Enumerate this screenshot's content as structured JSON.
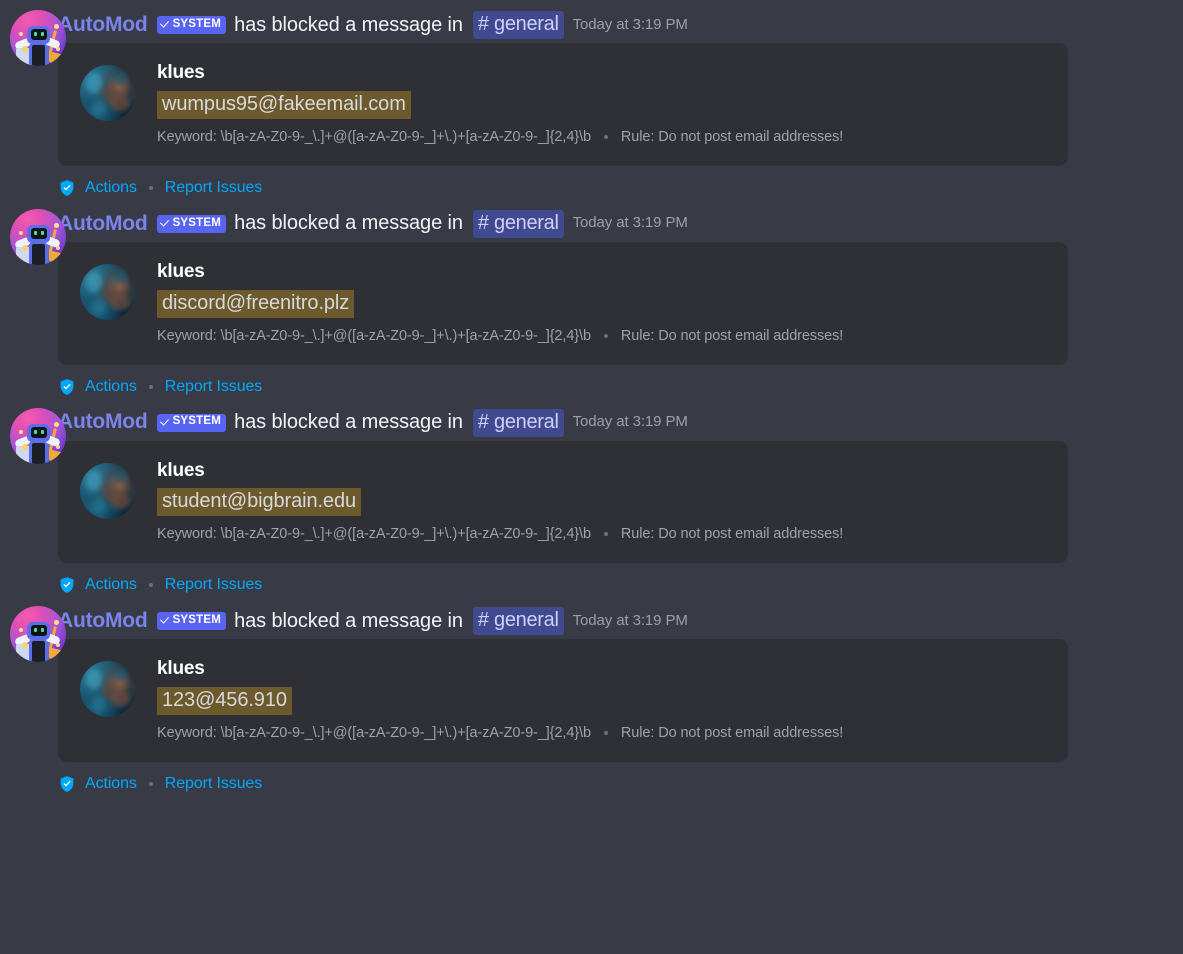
{
  "colors": {
    "page_background": "#383b45",
    "embed_background": "#2e3035",
    "bot_name": "#7a84eb",
    "system_badge": "#5865f2",
    "channel_pill_bg": "#414a8f",
    "channel_pill_text": "#ced0fa",
    "highlight_bg": "#6d5a2c",
    "link": "#00a8fc",
    "muted_text": "#9da3ab"
  },
  "labels": {
    "bot_name": "AutoMod",
    "system_badge": "SYSTEM",
    "blocked_text": "has blocked a message in",
    "channel": "# general",
    "timestamp": "Today at 3:19 PM",
    "keyword_prefix": "Keyword:",
    "rule_prefix": "Rule:",
    "actions": "Actions",
    "report_issues": "Report Issues"
  },
  "icons": {
    "shield": "shield-check-icon",
    "check": "check-icon",
    "hash": "hash-icon"
  },
  "entries": [
    {
      "bot_name": "AutoMod",
      "badge": "SYSTEM",
      "blocked_text": "has blocked a message in",
      "channel": "# general",
      "timestamp": "Today at 3:19 PM",
      "author": "klues",
      "content": "wumpus95@fakeemail.com",
      "keyword": "Keyword: \\b[a-zA-Z0-9-_\\.]+@([a-zA-Z0-9-_]+\\.)+[a-zA-Z0-9-_]{2,4}\\b",
      "rule": "Rule: Do not post email addresses!",
      "actions": "Actions",
      "report_issues": "Report Issues"
    },
    {
      "bot_name": "AutoMod",
      "badge": "SYSTEM",
      "blocked_text": "has blocked a message in",
      "channel": "# general",
      "timestamp": "Today at 3:19 PM",
      "author": "klues",
      "content": "discord@freenitro.plz",
      "keyword": "Keyword: \\b[a-zA-Z0-9-_\\.]+@([a-zA-Z0-9-_]+\\.)+[a-zA-Z0-9-_]{2,4}\\b",
      "rule": "Rule: Do not post email addresses!",
      "actions": "Actions",
      "report_issues": "Report Issues"
    },
    {
      "bot_name": "AutoMod",
      "badge": "SYSTEM",
      "blocked_text": "has blocked a message in",
      "channel": "# general",
      "timestamp": "Today at 3:19 PM",
      "author": "klues",
      "content": "student@bigbrain.edu",
      "keyword": "Keyword: \\b[a-zA-Z0-9-_\\.]+@([a-zA-Z0-9-_]+\\.)+[a-zA-Z0-9-_]{2,4}\\b",
      "rule": "Rule: Do not post email addresses!",
      "actions": "Actions",
      "report_issues": "Report Issues"
    },
    {
      "bot_name": "AutoMod",
      "badge": "SYSTEM",
      "blocked_text": "has blocked a message in",
      "channel": "# general",
      "timestamp": "Today at 3:19 PM",
      "author": "klues",
      "content": "123@456.910",
      "keyword": "Keyword: \\b[a-zA-Z0-9-_\\.]+@([a-zA-Z0-9-_]+\\.)+[a-zA-Z0-9-_]{2,4}\\b",
      "rule": "Rule: Do not post email addresses!",
      "actions": "Actions",
      "report_issues": "Report Issues"
    }
  ]
}
